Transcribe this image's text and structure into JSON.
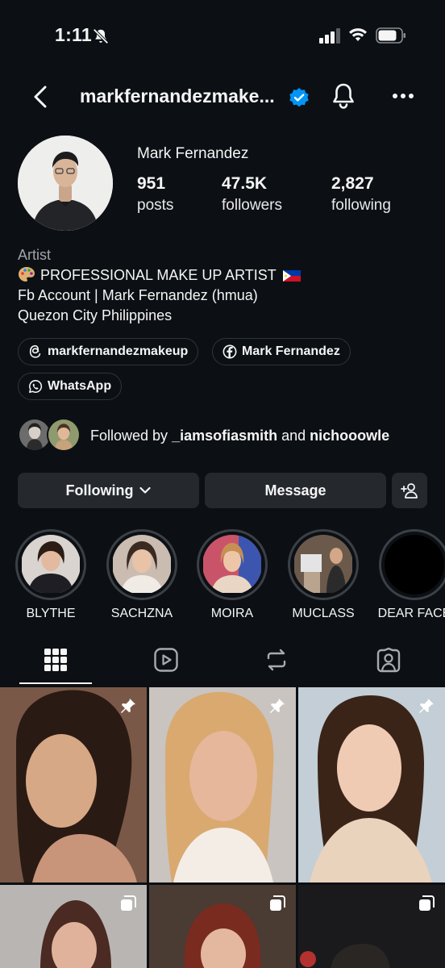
{
  "status_bar": {
    "time": "1:11"
  },
  "nav": {
    "username": "markfernandezmake..."
  },
  "profile": {
    "display_name": "Mark Fernandez",
    "stats": [
      {
        "value": "951",
        "label": "posts"
      },
      {
        "value": "47.5K",
        "label": "followers"
      },
      {
        "value": "2,827",
        "label": "following"
      }
    ],
    "bio": {
      "category": "Artist",
      "line1": "PROFESSIONAL MAKE UP ARTIST",
      "line2": "Fb Account | Mark Fernandez (hmua)",
      "line3": "Quezon City Philippines"
    },
    "links": [
      {
        "icon": "threads-icon",
        "label": "markfernandezmakeup"
      },
      {
        "icon": "facebook-icon",
        "label": "Mark Fernandez"
      },
      {
        "icon": "whatsapp-icon",
        "label": "WhatsApp"
      }
    ],
    "followed_by": {
      "prefix": "Followed by ",
      "user1": "_iamsofiasmith",
      "joiner": " and ",
      "user2": "nichooowle"
    }
  },
  "actions": {
    "following_label": "Following",
    "message_label": "Message"
  },
  "highlights": [
    "BLYTHE",
    "SACHZNA",
    "MOIRA",
    "MUCLASS",
    "DEAR FACE"
  ],
  "tabs": [
    "grid-icon",
    "reels-icon",
    "reposts-icon",
    "tagged-icon"
  ],
  "colors": {
    "background": "#0c1014",
    "button": "#25292e",
    "verified": "#0095f6"
  }
}
